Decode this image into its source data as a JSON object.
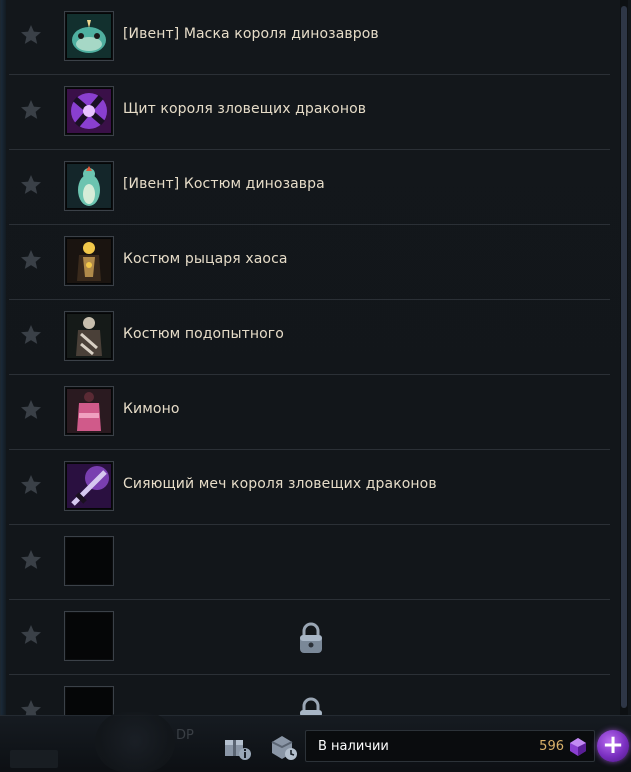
{
  "items": [
    {
      "name": "[Ивент] Маска короля динозавров",
      "icon": "dinosaur-king-mask-icon",
      "locked": false
    },
    {
      "name": "Щит короля зловещих драконов",
      "icon": "dragon-king-shield-icon",
      "locked": false
    },
    {
      "name": "[Ивент] Костюм динозавра",
      "icon": "dinosaur-costume-icon",
      "locked": false
    },
    {
      "name": "Костюм рыцаря хаоса",
      "icon": "chaos-knight-costume-icon",
      "locked": false
    },
    {
      "name": "Костюм подопытного",
      "icon": "test-subject-costume-icon",
      "locked": false
    },
    {
      "name": "Кимоно",
      "icon": "kimono-icon",
      "locked": false
    },
    {
      "name": "Сияющий меч короля зловещих драконов",
      "icon": "dragon-king-sword-icon",
      "locked": false
    },
    {
      "name": "",
      "icon": "empty-slot",
      "locked": false
    },
    {
      "name": "",
      "icon": "empty-slot",
      "locked": true
    },
    {
      "name": "",
      "icon": "empty-slot",
      "locked": true
    }
  ],
  "footer": {
    "dp_label": "DP",
    "available_label": "В наличии",
    "balance": "596",
    "plus": "+"
  },
  "colors": {
    "item_text": "#e6dcc8",
    "balance": "#d9b16a",
    "accent": "#8a3fd0"
  }
}
